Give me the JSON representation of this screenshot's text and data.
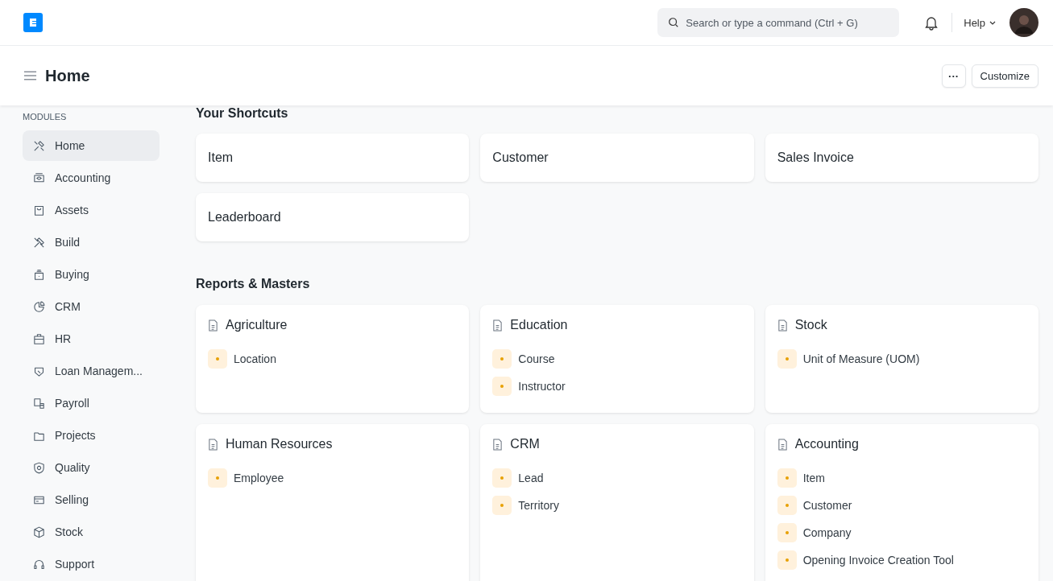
{
  "navbar": {
    "search": {
      "placeholder": "Search or type a command (Ctrl + G)"
    },
    "help": "Help"
  },
  "page_head": {
    "title": "Home",
    "more": "···",
    "customize": "Customize"
  },
  "sidebar": {
    "heading": "MODULES",
    "items": [
      {
        "label": "Home",
        "selected": true
      },
      {
        "label": "Accounting",
        "selected": false
      },
      {
        "label": "Assets",
        "selected": false
      },
      {
        "label": "Build",
        "selected": false
      },
      {
        "label": "Buying",
        "selected": false
      },
      {
        "label": "CRM",
        "selected": false
      },
      {
        "label": "HR",
        "selected": false
      },
      {
        "label": "Loan Managem...",
        "selected": false
      },
      {
        "label": "Payroll",
        "selected": false
      },
      {
        "label": "Projects",
        "selected": false
      },
      {
        "label": "Quality",
        "selected": false
      },
      {
        "label": "Selling",
        "selected": false
      },
      {
        "label": "Stock",
        "selected": false
      },
      {
        "label": "Support",
        "selected": false
      }
    ]
  },
  "shortcuts": {
    "title": "Your Shortcuts",
    "items": [
      "Item",
      "Customer",
      "Sales Invoice",
      "Leaderboard"
    ]
  },
  "reports": {
    "title": "Reports & Masters",
    "cards": [
      {
        "title": "Agriculture",
        "links": [
          "Location"
        ]
      },
      {
        "title": "Education",
        "links": [
          "Course",
          "Instructor"
        ]
      },
      {
        "title": "Stock",
        "links": [
          "Unit of Measure (UOM)"
        ]
      },
      {
        "title": "Human Resources",
        "links": [
          "Employee"
        ]
      },
      {
        "title": "CRM",
        "links": [
          "Lead",
          "Territory"
        ]
      },
      {
        "title": "Accounting",
        "links": [
          "Item",
          "Customer",
          "Company",
          "Opening Invoice Creation Tool"
        ]
      }
    ]
  }
}
